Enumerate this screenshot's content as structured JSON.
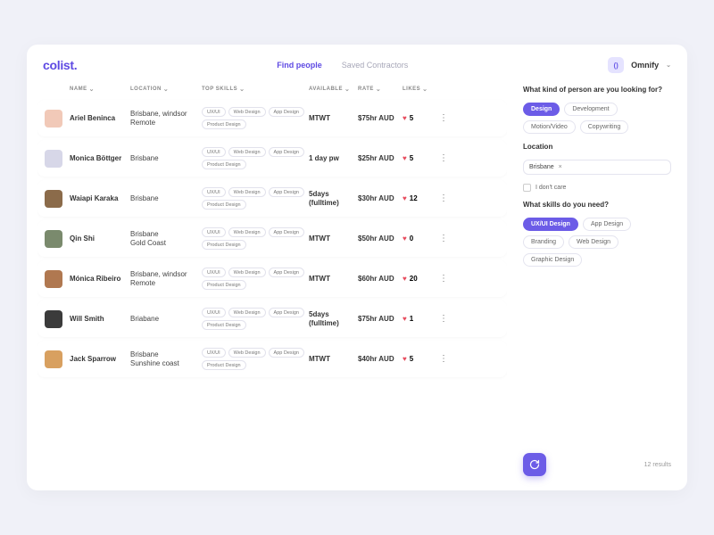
{
  "brand": "colist.",
  "nav": {
    "find": "Find people",
    "saved": "Saved Contractors"
  },
  "org": {
    "name": "Omnify",
    "initials": "()"
  },
  "cols": {
    "name": "NAME",
    "location": "LOCATION",
    "skills": "TOP SKILLS",
    "available": "AVAILABLE",
    "rate": "RATE",
    "likes": "LIKES"
  },
  "rows": [
    {
      "name": "Ariel Beninca",
      "location": "Brisbane, windsor\nRemote",
      "skills": [
        "UX/UI",
        "Web Design",
        "App Design",
        "Product Design"
      ],
      "available": "MTWT",
      "rate": "$75hr AUD",
      "likes": 5,
      "av": "#f1c9b8"
    },
    {
      "name": "Monica Böttger",
      "location": "Brisbane",
      "skills": [
        "UX/UI",
        "Web Design",
        "App Design",
        "Product Design"
      ],
      "available": "1 day pw",
      "rate": "$25hr AUD",
      "likes": 5,
      "av": "#d7d7e8"
    },
    {
      "name": "Waiapi Karaka",
      "location": "Brisbane",
      "skills": [
        "UX/UI",
        "Web Design",
        "App Design",
        "Product Design"
      ],
      "available": "5days\n(fulltime)",
      "rate": "$30hr AUD",
      "likes": 12,
      "av": "#8b6b4a"
    },
    {
      "name": "Qin Shi",
      "location": "Brisbane\nGold Coast",
      "skills": [
        "UX/UI",
        "Web Design",
        "App Design",
        "Product Design"
      ],
      "available": "MTWT",
      "rate": "$50hr AUD",
      "likes": 0,
      "av": "#7a8a6d"
    },
    {
      "name": "Mónica Ribeiro",
      "location": "Brisbane, windsor\nRemote",
      "skills": [
        "UX/UI",
        "Web Design",
        "App Design",
        "Product Design"
      ],
      "available": "MTWT",
      "rate": "$60hr AUD",
      "likes": 20,
      "av": "#b07850"
    },
    {
      "name": "Will Smith",
      "location": "Briabane",
      "skills": [
        "UX/UI",
        "Web Design",
        "App Design",
        "Product Design"
      ],
      "available": "5days\n(fulltime)",
      "rate": "$75hr AUD",
      "likes": 1,
      "av": "#3b3b3b"
    },
    {
      "name": "Jack Sparrow",
      "location": "Brisbane\nSunshine coast",
      "skills": [
        "UX/UI",
        "Web Design",
        "App Design",
        "Product Design"
      ],
      "available": "MTWT",
      "rate": "$40hr AUD",
      "likes": 5,
      "av": "#d8a060"
    }
  ],
  "filters": {
    "q1": "What kind of person are you looking for?",
    "kinds": [
      {
        "label": "Design",
        "sel": true
      },
      {
        "label": "Development",
        "sel": false
      },
      {
        "label": "Motion/Video",
        "sel": false
      },
      {
        "label": "Copywriting",
        "sel": false
      }
    ],
    "locLabel": "Location",
    "locTag": "Brisbane",
    "dontcare": "I don't care",
    "q2": "What skills do you need?",
    "skills": [
      {
        "label": "UX/UI Design",
        "sel": true
      },
      {
        "label": "App Design",
        "sel": false
      },
      {
        "label": "Branding",
        "sel": false
      },
      {
        "label": "Web Design",
        "sel": false
      },
      {
        "label": "Graphic Design",
        "sel": false
      }
    ],
    "results": "12 results"
  }
}
